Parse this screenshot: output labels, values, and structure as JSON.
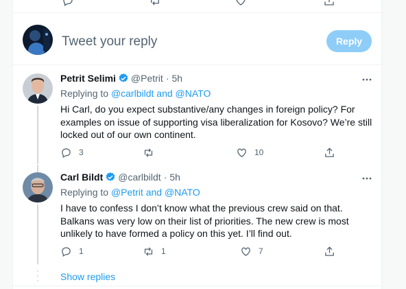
{
  "composer": {
    "placeholder": "Tweet your reply",
    "reply_label": "Reply"
  },
  "replies": [
    {
      "name": "Petrit Selimi",
      "handle": "@Petrit",
      "time": "5h",
      "replying_prefix": "Replying to ",
      "replying_to": "@carlbildt and @NATO",
      "text": "Hi Carl, do you expect substantive/any changes in foreign policy? For examples on issue of supporting visa liberalization for Kosovo? We’re still locked out of our own continent.",
      "reply_count": "3",
      "retweet_count": "",
      "like_count": "10"
    },
    {
      "name": "Carl Bildt",
      "handle": "@carlbildt",
      "time": "5h",
      "replying_prefix": "Replying to ",
      "replying_to": "@Petrit and @NATO",
      "text": "I have to confess I don’t know what the previous crew said on that. Balkans was very low on their list of priorities. The new crew is most unlikely to have formed a policy on this yet. I’ll find out.",
      "reply_count": "1",
      "retweet_count": "1",
      "like_count": "7"
    }
  ],
  "show_replies_label": "Show replies",
  "icons": {
    "verified": "verified-badge-icon",
    "more": "more-icon",
    "reply": "reply-icon",
    "retweet": "retweet-icon",
    "like": "like-icon",
    "share": "share-icon"
  },
  "colors": {
    "accent": "#1d9bf0",
    "reply_button_disabled": "#8ecdf8",
    "muted_text": "#536471"
  }
}
